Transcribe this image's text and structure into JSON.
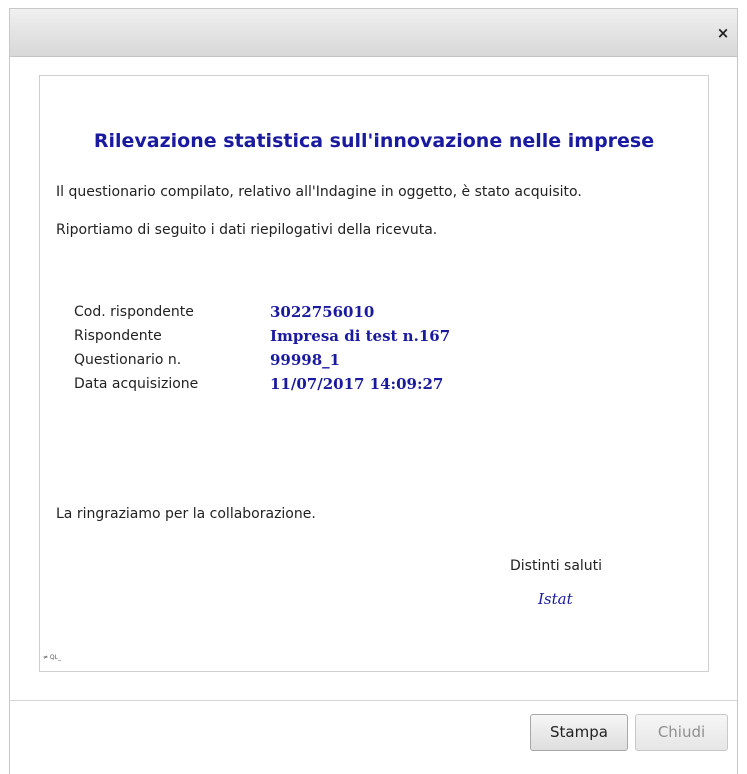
{
  "dialog": {
    "close_glyph": "×"
  },
  "document": {
    "title": "Rilevazione statistica sull'innovazione nelle imprese",
    "intro_line1": "Il questionario compilato, relativo all'Indagine in oggetto, è stato acquisito.",
    "intro_line2": "Riportiamo di seguito i dati riepilogativi della ricevuta.",
    "summary": [
      {
        "label": "Cod. rispondente",
        "value": "3022756010"
      },
      {
        "label": "Rispondente",
        "value": "Impresa di test n.167"
      },
      {
        "label": "Questionario n.",
        "value": "99998_1"
      },
      {
        "label": "Data acquisizione",
        "value": "11/07/2017 14:09:27"
      }
    ],
    "thanks": "La ringraziamo per la collaborazione.",
    "regards": "Distinti saluti",
    "signature": "Istat",
    "footer_code": "≠ QL_"
  },
  "buttons": {
    "print_label": "Stampa",
    "close_label": "Chiudi"
  },
  "colors": {
    "accent_text": "#1a1aa0",
    "body_text": "#222222",
    "disabled_text": "#8f8f8f"
  }
}
